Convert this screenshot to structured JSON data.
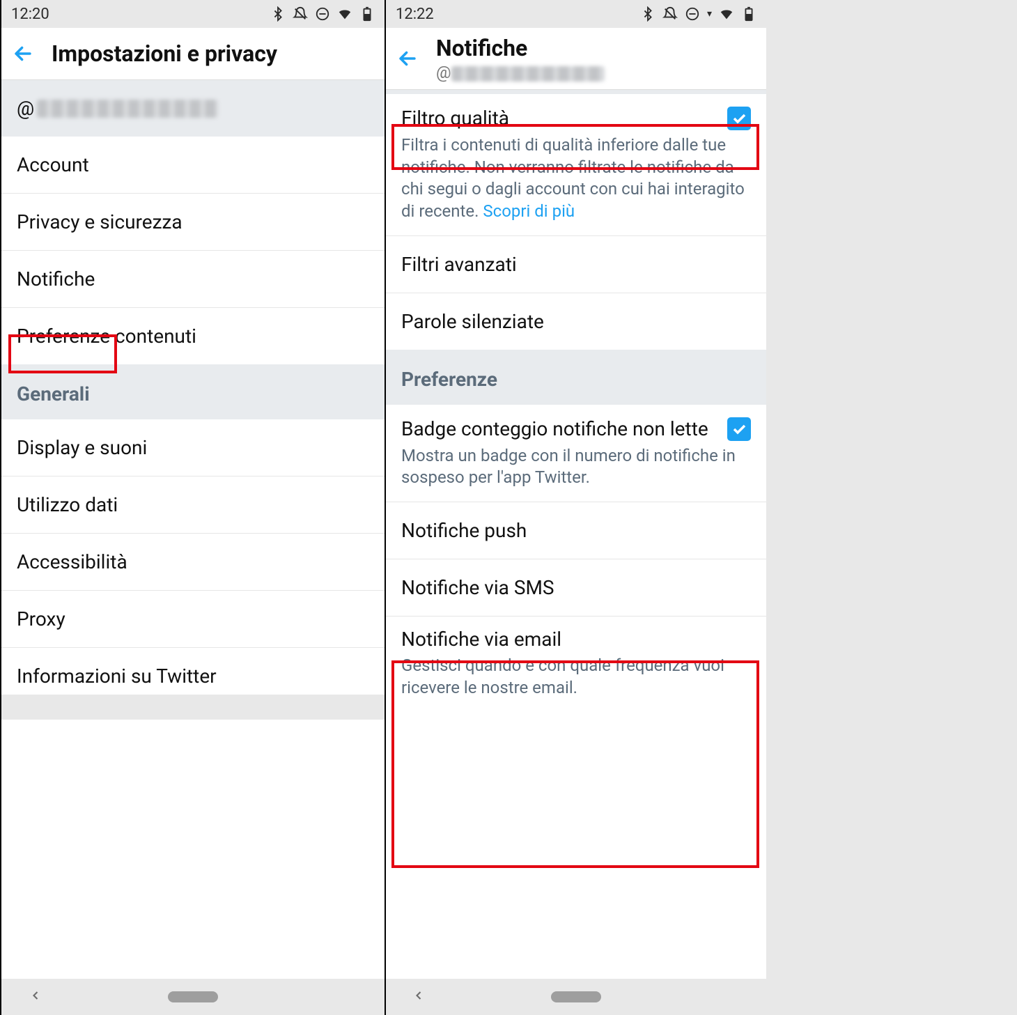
{
  "left": {
    "status_time": "12:20",
    "appbar_title": "Impostazioni e privacy",
    "username_prefix": "@",
    "items_top": [
      "Account",
      "Privacy e sicurezza",
      "Notifiche",
      "Preferenze contenuti"
    ],
    "section_general": "Generali",
    "items_general": [
      "Display e suoni",
      "Utilizzo dati",
      "Accessibilità",
      "Proxy",
      "Informazioni su Twitter"
    ]
  },
  "right": {
    "status_time": "12:22",
    "appbar_title": "Notifiche",
    "username_prefix": "@",
    "quality_filter_title": "Filtro qualità",
    "quality_filter_desc": "Filtra i contenuti di qualità inferiore dalle tue notifiche. Non verranno filtrate le notifiche da chi segui o dagli account con cui hai interagito di recente. ",
    "quality_filter_link": "Scopri di più",
    "advanced_filters": "Filtri avanzati",
    "muted_words": "Parole silenziate",
    "section_prefs": "Preferenze",
    "badge_title": "Badge conteggio notifiche non lette",
    "badge_desc": "Mostra un badge con il numero di notifiche in sospeso per l'app Twitter.",
    "push_title": "Notifiche push",
    "sms_title": "Notifiche via SMS",
    "email_title": "Notifiche via email",
    "email_desc": "Gestisci quando e con quale frequenza vuoi ricevere le nostre email."
  }
}
